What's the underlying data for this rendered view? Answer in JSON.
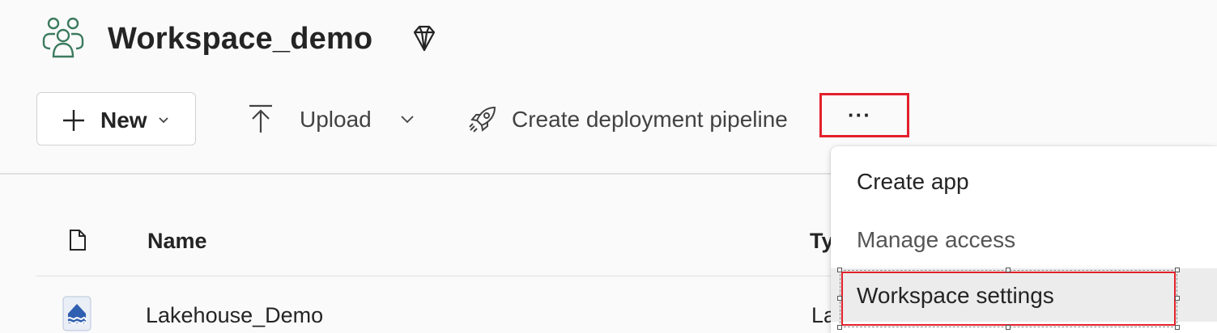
{
  "workspace": {
    "title": "Workspace_demo",
    "icon": "workspace-people-icon",
    "premium_icon": "diamond-icon"
  },
  "toolbar": {
    "new_label": "New",
    "upload_label": "Upload",
    "deploy_label": "Create deployment pipeline",
    "more_label": "···"
  },
  "table": {
    "columns": [
      "Name",
      "Ty"
    ],
    "rows": [
      {
        "name": "Lakehouse_Demo",
        "type": "La",
        "icon": "lakehouse-icon"
      }
    ]
  },
  "menu": {
    "items": [
      {
        "label": "Create app"
      },
      {
        "label": "Manage access"
      },
      {
        "label": "Workspace settings"
      }
    ]
  },
  "colors": {
    "accent_green": "#3b7a5e",
    "highlight_red": "#e3202c",
    "lakehouse_blue": "#2f5fb0"
  }
}
